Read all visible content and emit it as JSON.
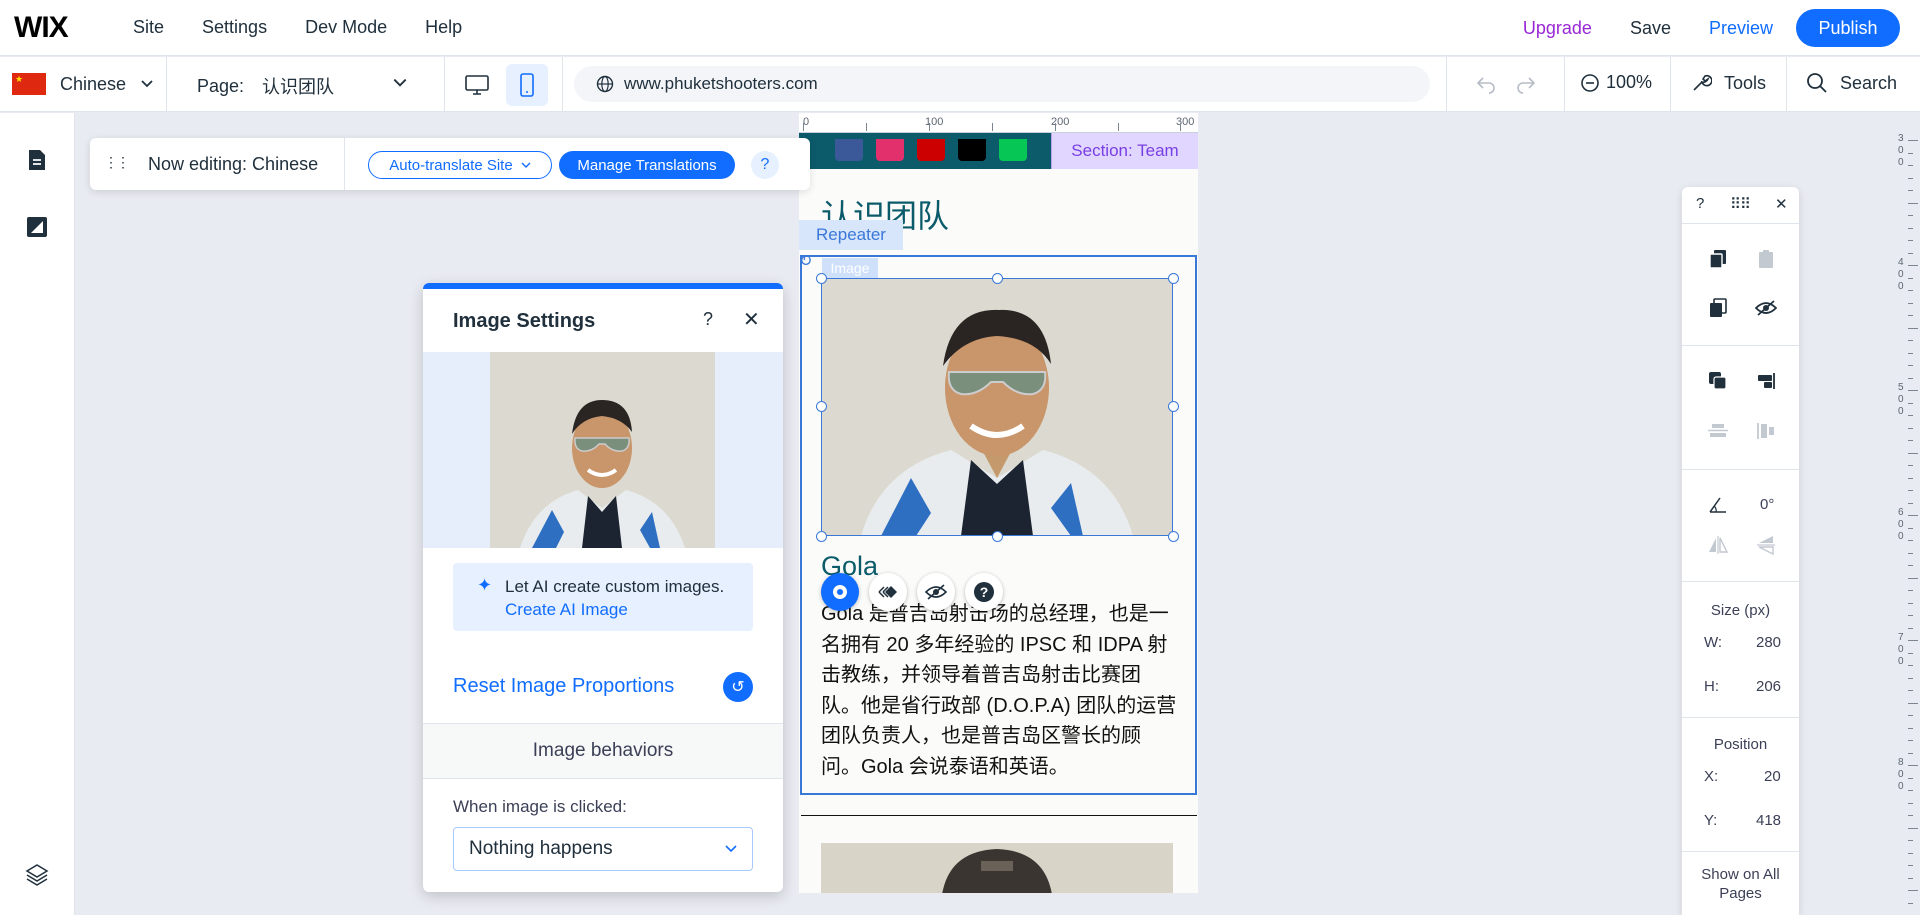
{
  "topbar": {
    "logo": "WIX",
    "menu": [
      "Site",
      "Settings",
      "Dev Mode",
      "Help"
    ],
    "upgrade": "Upgrade",
    "save": "Save",
    "preview": "Preview",
    "publish": "Publish"
  },
  "toolbar": {
    "language": "Chinese",
    "page_label": "Page:",
    "page_name": "认识团队",
    "url": "www.phuketshooters.com",
    "zoom": "100%",
    "tools": "Tools",
    "search": "Search"
  },
  "editbar": {
    "now_editing": "Now editing: Chinese",
    "auto_translate": "Auto-translate Site",
    "manage_translations": "Manage Translations",
    "help": "?"
  },
  "image_settings": {
    "title": "Image Settings",
    "help": "?",
    "close": "✕",
    "ai_text": "Let AI create custom images.",
    "ai_link": "Create AI Image",
    "reset": "Reset Image Proportions",
    "behaviors_header": "Image behaviors",
    "click_label": "When image is clicked:",
    "click_value": "Nothing happens"
  },
  "canvas": {
    "ruler_labels": [
      "0",
      "100",
      "200",
      "300"
    ],
    "section_tag": "Section: Team",
    "page_title": "认识团队",
    "repeater_tag": "Repeater",
    "image_tag": "Image",
    "member_name": "Gola",
    "member_bio": "Gola 是普吉岛射击场的总经理，也是一名拥有 20 多年经验的 IPSC 和 IDPA 射击教练，并领导着普吉岛射击比赛团队。他是省行政部 (D.O.P.A) 团队的运营团队负责人，也是普吉岛区警长的顾问。Gola 会说泰语和英语。"
  },
  "right_panel": {
    "help": "?",
    "close": "✕",
    "rotation": "0°",
    "size_label": "Size (px)",
    "w_label": "W:",
    "w_value": "280",
    "h_label": "H:",
    "h_value": "206",
    "position_label": "Position",
    "x_label": "X:",
    "x_value": "20",
    "y_label": "Y:",
    "y_value": "418",
    "show_all_pages": "Show on All Pages"
  },
  "vruler": [
    "3",
    "0",
    "0",
    "4",
    "0",
    "0",
    "5",
    "0",
    "0",
    "6",
    "0",
    "0",
    "7",
    "0",
    "0",
    "8",
    "0",
    "0"
  ],
  "colors": {
    "accent": "#116dff",
    "upgrade": "#9a27d5",
    "site_teal": "#0b5b6b",
    "section_purple": "#7a3fe4"
  }
}
